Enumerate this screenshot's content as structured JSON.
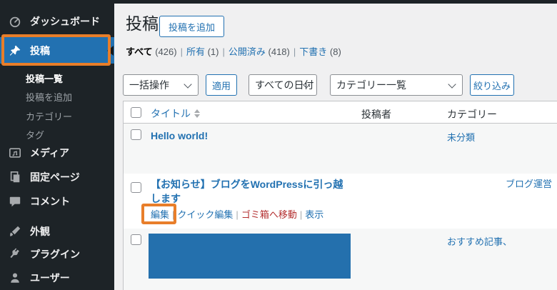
{
  "colors": {
    "accent_blue": "#2271b1",
    "annotation_orange": "#e87e2a",
    "trash_red": "#b32d2e",
    "redaction_blue": "#2470ad",
    "sidebar_bg": "#1d2327",
    "row_stripe": "#f6f7f7"
  },
  "sidebar": {
    "items": [
      {
        "label": "ダッシュボード",
        "icon": "dashboard-icon"
      },
      {
        "label": "投稿",
        "icon": "pushpin-icon",
        "active": true
      },
      {
        "label": "メディア",
        "icon": "media-icon"
      },
      {
        "label": "固定ページ",
        "icon": "pages-icon"
      },
      {
        "label": "コメント",
        "icon": "comments-icon"
      },
      {
        "label": "外観",
        "icon": "appearance-icon"
      },
      {
        "label": "プラグイン",
        "icon": "plugin-icon"
      },
      {
        "label": "ユーザー",
        "icon": "users-icon"
      }
    ],
    "posts_submenu": [
      {
        "label": "投稿一覧",
        "current": true
      },
      {
        "label": "投稿を追加"
      },
      {
        "label": "カテゴリー"
      },
      {
        "label": "タグ"
      }
    ]
  },
  "page": {
    "title": "投稿",
    "add_new_button": "投稿を追加"
  },
  "status_filters": {
    "separator": "|",
    "items": [
      {
        "label": "すべて",
        "count": "(426)",
        "current": true
      },
      {
        "label": "所有",
        "count": "(1)"
      },
      {
        "label": "公開済み",
        "count": "(418)"
      },
      {
        "label": "下書き",
        "count": "(8)"
      }
    ]
  },
  "toolbar": {
    "bulk_actions_select": "一括操作",
    "apply_button": "適用",
    "dates_select": "すべての日付",
    "categories_select": "カテゴリー一覧",
    "filter_button": "絞り込み"
  },
  "table": {
    "columns": {
      "title": "タイトル",
      "author": "投稿者",
      "category": "カテゴリー"
    },
    "rows": [
      {
        "title": "Hello world!",
        "author": "",
        "category": "未分類"
      },
      {
        "title": "【お知らせ】ブログをWordPressに引っ越します",
        "author": "",
        "category": "ブログ運営"
      },
      {
        "title": "",
        "author": "",
        "category": "おすすめ記事、",
        "redacted": true
      }
    ],
    "row_actions": {
      "separator": "|",
      "edit": "編集",
      "quick_edit": "クイック編集",
      "trash": "ゴミ箱へ移動",
      "view": "表示"
    }
  }
}
